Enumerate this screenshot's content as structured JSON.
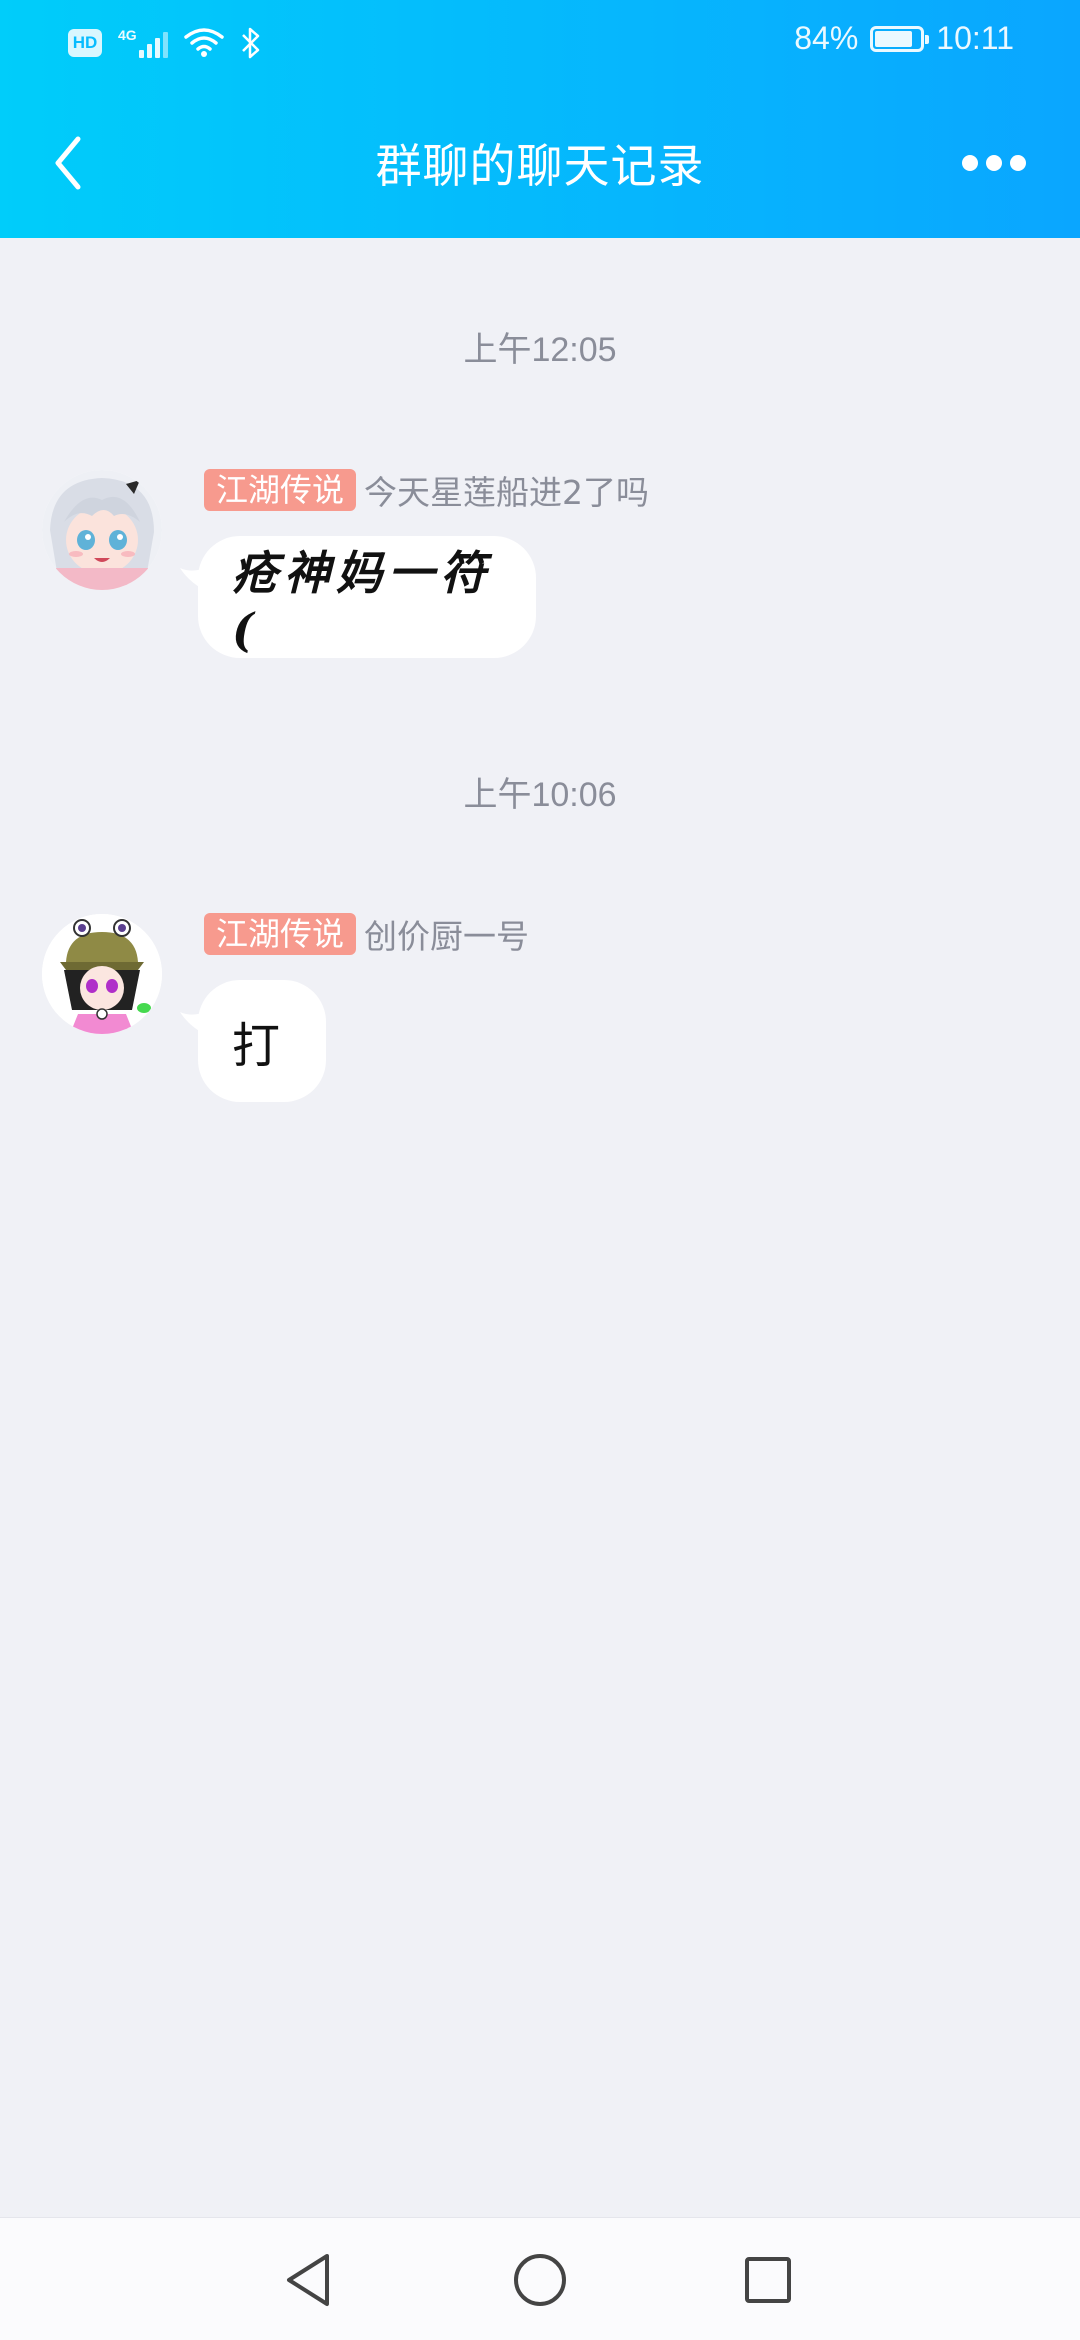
{
  "status_bar": {
    "hd": "HD",
    "network": "4G",
    "battery_percent": "84%",
    "battery_level": 0.84,
    "time": "10:11",
    "icons": [
      "hd-icon",
      "signal-icon",
      "wifi-icon",
      "bluetooth-icon",
      "battery-icon"
    ]
  },
  "header": {
    "title": "群聊的聊天记录",
    "back_icon": "chevron-left-icon",
    "more_icon": "more-dots-icon"
  },
  "messages": [
    {
      "timestamp": "上午12:05",
      "tag": "江湖传说",
      "sender": "今天星莲船进2了吗",
      "text": "疮神妈一符(",
      "avatar": "avatar-white-hair-girl"
    },
    {
      "timestamp": "上午10:06",
      "tag": "江湖传说",
      "sender": "创价厨一号",
      "text": "打",
      "avatar": "avatar-frog-hat-girl"
    }
  ],
  "colors": {
    "header_gradient_start": "#00cdfa",
    "header_gradient_end": "#0aa6ff",
    "tag_bg": "#f79a8e",
    "background": "#f0f1f6",
    "bubble_bg": "#ffffff"
  },
  "nav_bar": {
    "icons": [
      "nav-back-icon",
      "nav-home-icon",
      "nav-recents-icon"
    ]
  }
}
